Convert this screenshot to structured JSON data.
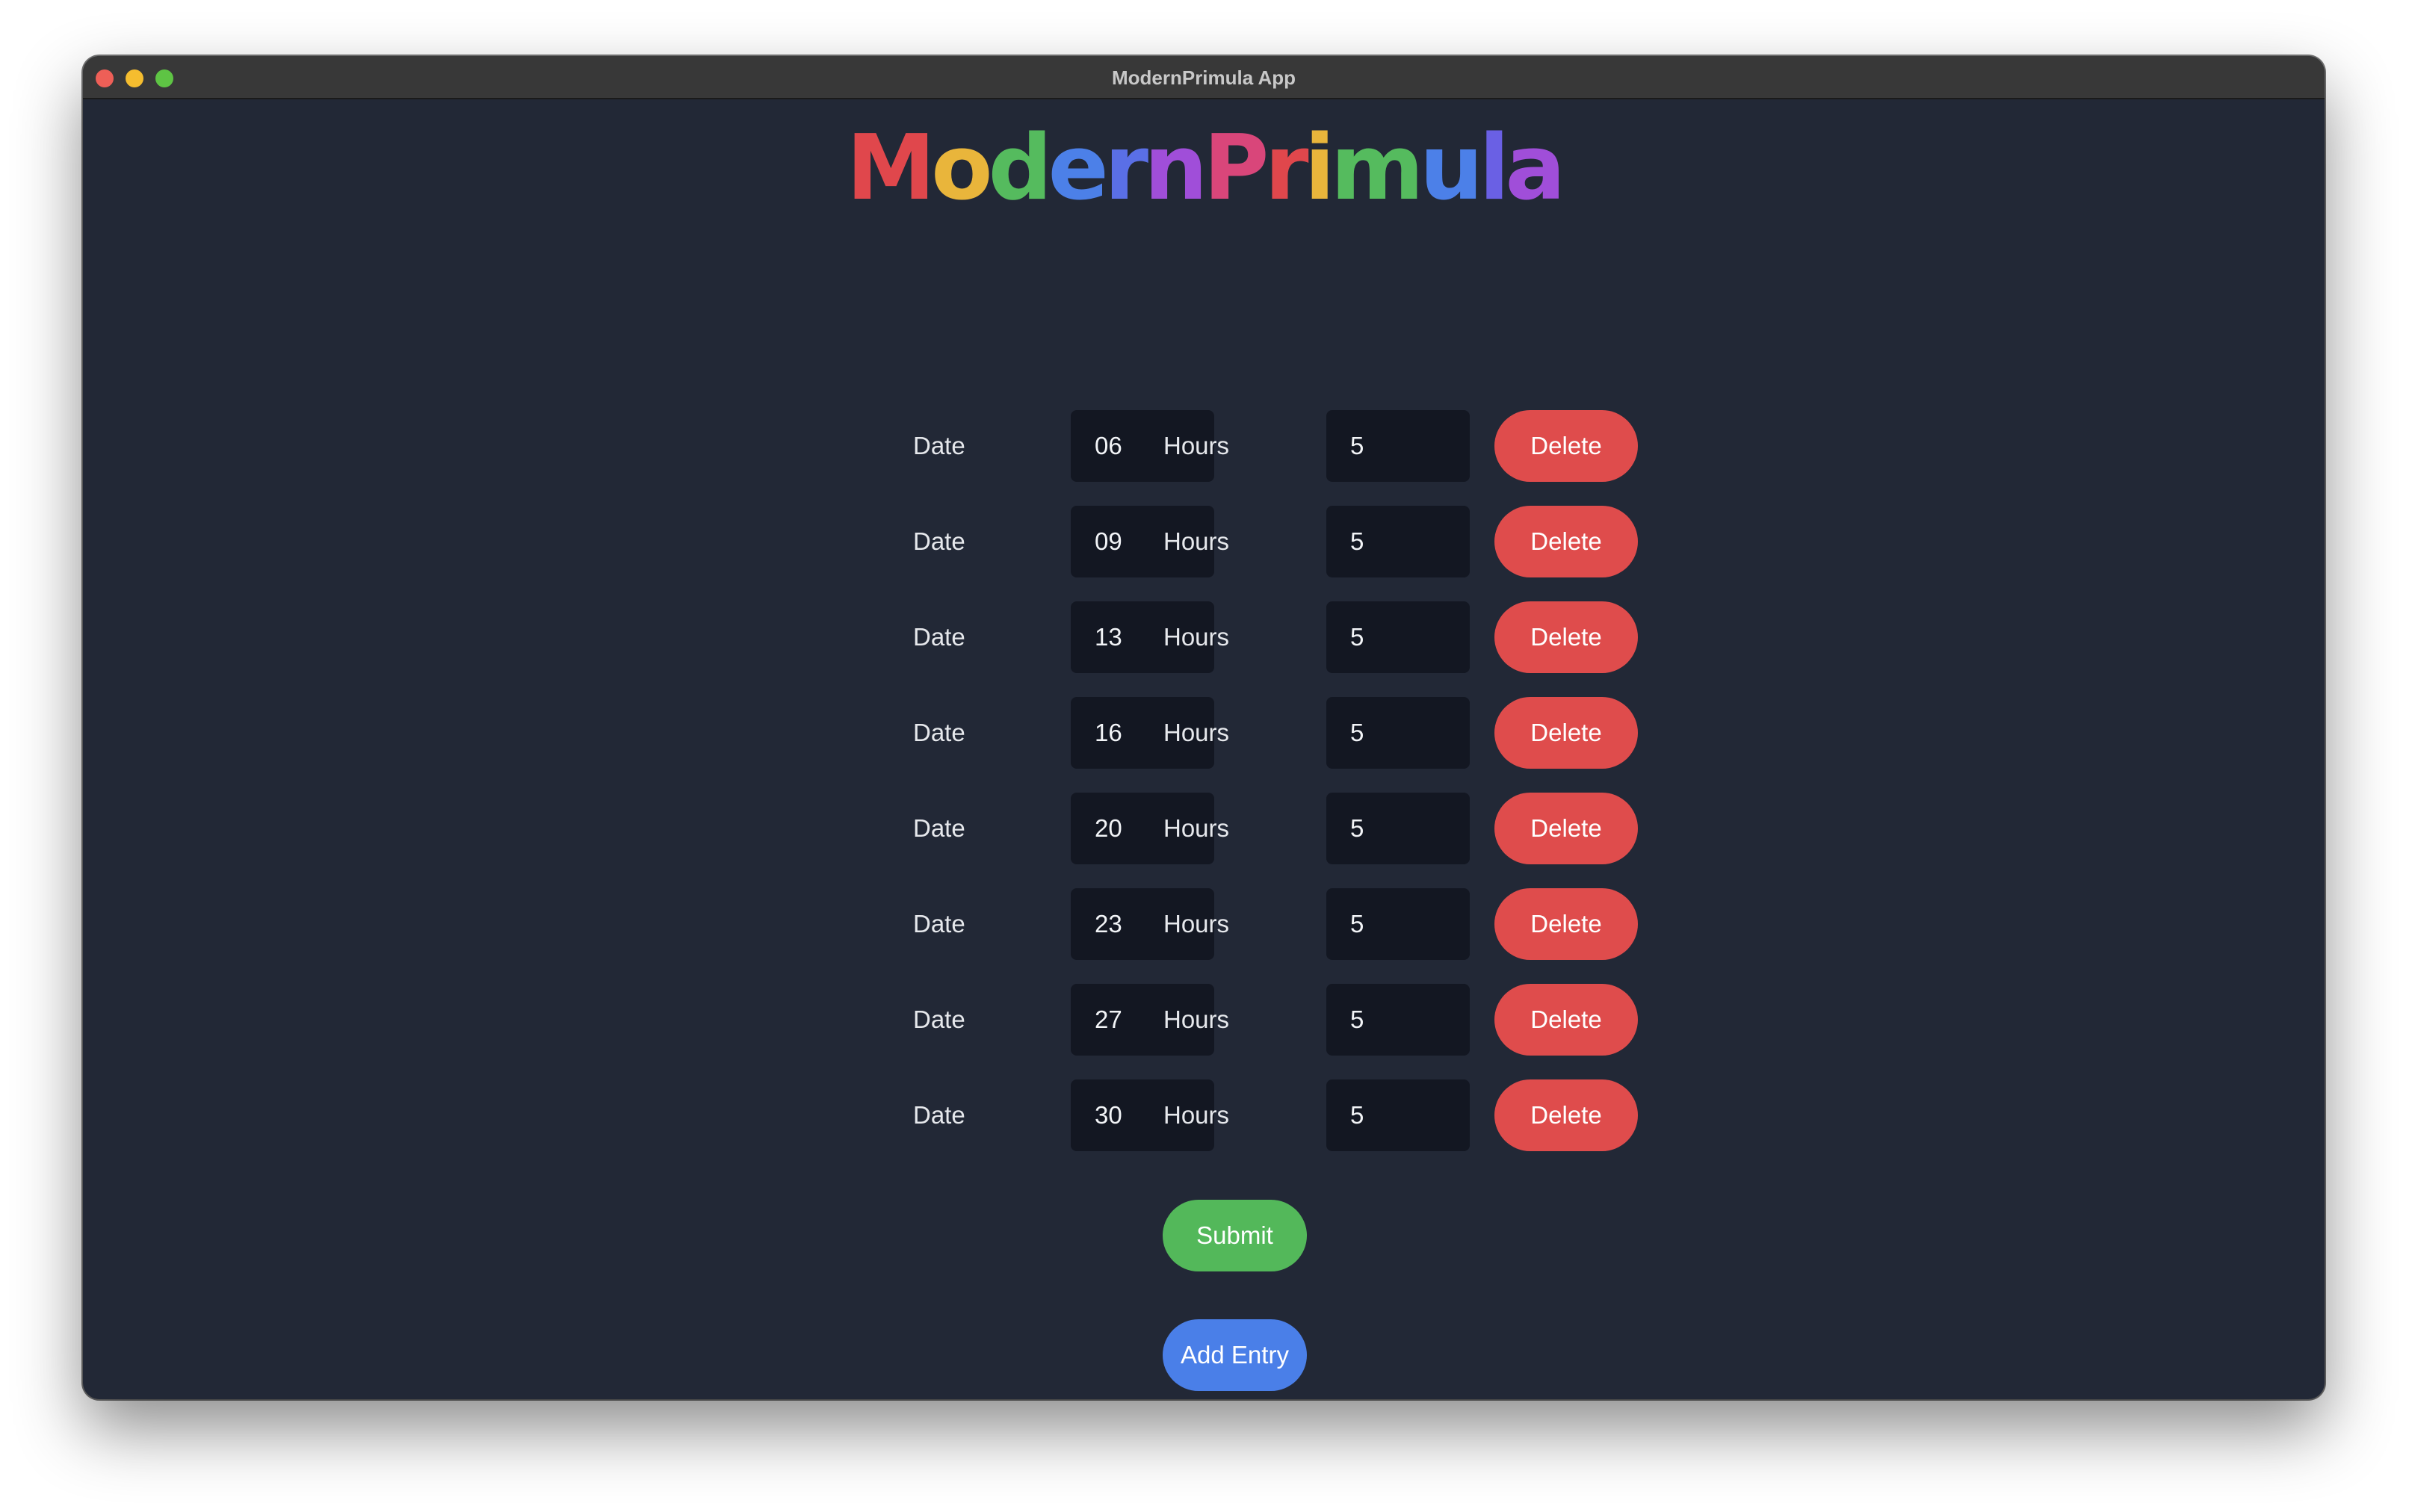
{
  "window": {
    "title": "ModernPrimula App"
  },
  "logo": {
    "text": "ModernPrimula",
    "letters": [
      {
        "char": "M",
        "color": "#e0474c"
      },
      {
        "char": "o",
        "color": "#e9b53b"
      },
      {
        "char": "d",
        "color": "#55bb5e"
      },
      {
        "char": "e",
        "color": "#4c80e8"
      },
      {
        "char": "r",
        "color": "#5a6fe6"
      },
      {
        "char": "n",
        "color": "#a04ed9"
      },
      {
        "char": "P",
        "color": "#d9467a"
      },
      {
        "char": "r",
        "color": "#e0474c"
      },
      {
        "char": "i",
        "color": "#e9b53b"
      },
      {
        "char": "m",
        "color": "#55bb5e"
      },
      {
        "char": "u",
        "color": "#4c80e8"
      },
      {
        "char": "l",
        "color": "#6a60e4"
      },
      {
        "char": "a",
        "color": "#a04ed9"
      }
    ]
  },
  "entries": [
    {
      "date_label": "Date",
      "date": "06",
      "hours_label": "Hours",
      "hours": "5",
      "delete_label": "Delete"
    },
    {
      "date_label": "Date",
      "date": "09",
      "hours_label": "Hours",
      "hours": "5",
      "delete_label": "Delete"
    },
    {
      "date_label": "Date",
      "date": "13",
      "hours_label": "Hours",
      "hours": "5",
      "delete_label": "Delete"
    },
    {
      "date_label": "Date",
      "date": "16",
      "hours_label": "Hours",
      "hours": "5",
      "delete_label": "Delete"
    },
    {
      "date_label": "Date",
      "date": "20",
      "hours_label": "Hours",
      "hours": "5",
      "delete_label": "Delete"
    },
    {
      "date_label": "Date",
      "date": "23",
      "hours_label": "Hours",
      "hours": "5",
      "delete_label": "Delete"
    },
    {
      "date_label": "Date",
      "date": "27",
      "hours_label": "Hours",
      "hours": "5",
      "delete_label": "Delete"
    },
    {
      "date_label": "Date",
      "date": "30",
      "hours_label": "Hours",
      "hours": "5",
      "delete_label": "Delete"
    }
  ],
  "actions": {
    "submit_label": "Submit",
    "add_entry_label": "Add Entry"
  },
  "colors": {
    "delete": "#df4c4c",
    "submit": "#53b85a",
    "add_entry": "#4a7fe8",
    "background": "#222836",
    "field": "#131722"
  }
}
